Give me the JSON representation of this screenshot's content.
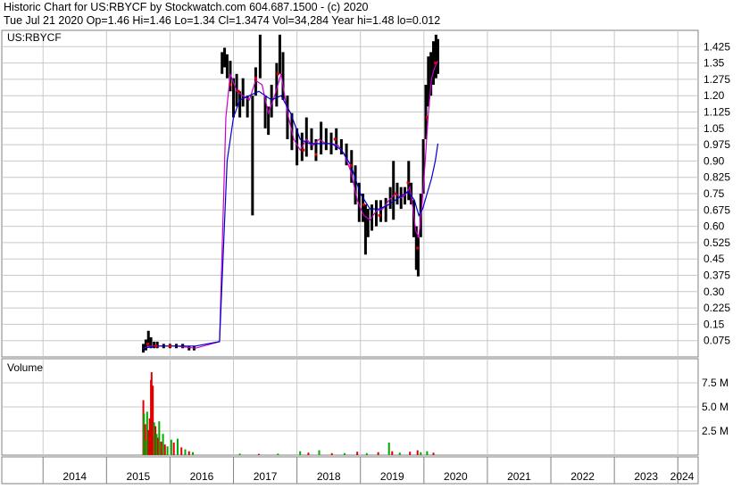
{
  "header": {
    "line1": "Historic Chart for US:RBYCF by Stockwatch.com 604.687.1500 - (c) 2020",
    "line2": "Tue Jul 21 2020  Op=1.46  Hi=1.46  Lo=1.34  Cl=1.3474  Vol=34,284  Year hi=1.48  lo=0.012"
  },
  "chart_data": [
    {
      "type": "line",
      "title": "US:RBYCF",
      "xlabel": "",
      "ylabel": "",
      "ylim": [
        0,
        1.5
      ],
      "yticks": [
        "0.075",
        "0.15",
        "0.225",
        "0.30",
        "0.375",
        "0.45",
        "0.525",
        "0.60",
        "0.675",
        "0.75",
        "0.825",
        "0.90",
        "0.975",
        "1.05",
        "1.125",
        "1.20",
        "1.275",
        "1.35",
        "1.425"
      ],
      "xtick_labels": [
        "2014",
        "2015",
        "2016",
        "2017",
        "2018",
        "2019",
        "2020",
        "2021",
        "2022",
        "2023",
        "2024"
      ],
      "grid": true,
      "legend": "none",
      "price_color": "#000000",
      "colors": {
        "ma_short": "#cc00cc",
        "ma_long": "#0000cc",
        "trade_marks": "#dd0000"
      },
      "price_ranges": [
        {
          "t": 2015.58,
          "low": 0.02,
          "high": 0.06
        },
        {
          "t": 2015.62,
          "low": 0.03,
          "high": 0.08
        },
        {
          "t": 2015.66,
          "low": 0.05,
          "high": 0.12
        },
        {
          "t": 2015.7,
          "low": 0.04,
          "high": 0.09
        },
        {
          "t": 2015.75,
          "low": 0.04,
          "high": 0.07
        },
        {
          "t": 2015.8,
          "low": 0.04,
          "high": 0.07
        },
        {
          "t": 2015.9,
          "low": 0.04,
          "high": 0.06
        },
        {
          "t": 2016.0,
          "low": 0.04,
          "high": 0.06
        },
        {
          "t": 2016.1,
          "low": 0.04,
          "high": 0.06
        },
        {
          "t": 2016.2,
          "low": 0.04,
          "high": 0.06
        },
        {
          "t": 2016.3,
          "low": 0.03,
          "high": 0.05
        },
        {
          "t": 2016.38,
          "low": 0.03,
          "high": 0.05
        },
        {
          "t": 2016.82,
          "low": 1.3,
          "high": 1.4
        },
        {
          "t": 2016.86,
          "low": 1.33,
          "high": 1.42
        },
        {
          "t": 2016.9,
          "low": 1.28,
          "high": 1.39
        },
        {
          "t": 2016.95,
          "low": 1.22,
          "high": 1.36
        },
        {
          "t": 2017.0,
          "low": 1.1,
          "high": 1.28
        },
        {
          "t": 2017.05,
          "low": 1.15,
          "high": 1.3
        },
        {
          "t": 2017.1,
          "low": 1.1,
          "high": 1.22
        },
        {
          "t": 2017.15,
          "low": 1.15,
          "high": 1.28
        },
        {
          "t": 2017.22,
          "low": 1.1,
          "high": 1.2
        },
        {
          "t": 2017.3,
          "low": 0.65,
          "high": 1.2
        },
        {
          "t": 2017.35,
          "low": 1.2,
          "high": 1.33
        },
        {
          "t": 2017.42,
          "low": 1.28,
          "high": 1.48
        },
        {
          "t": 2017.5,
          "low": 1.05,
          "high": 1.2
        },
        {
          "t": 2017.55,
          "low": 1.02,
          "high": 1.15
        },
        {
          "t": 2017.6,
          "low": 1.1,
          "high": 1.25
        },
        {
          "t": 2017.68,
          "low": 1.15,
          "high": 1.35
        },
        {
          "t": 2017.73,
          "low": 1.3,
          "high": 1.48
        },
        {
          "t": 2017.78,
          "low": 1.18,
          "high": 1.4
        },
        {
          "t": 2017.85,
          "low": 1.0,
          "high": 1.2
        },
        {
          "t": 2017.92,
          "low": 0.95,
          "high": 1.12
        },
        {
          "t": 2018.0,
          "low": 0.88,
          "high": 1.05
        },
        {
          "t": 2018.08,
          "low": 0.9,
          "high": 1.03
        },
        {
          "t": 2018.15,
          "low": 0.92,
          "high": 1.1
        },
        {
          "t": 2018.23,
          "low": 0.95,
          "high": 1.05
        },
        {
          "t": 2018.3,
          "low": 0.9,
          "high": 1.0
        },
        {
          "t": 2018.38,
          "low": 0.93,
          "high": 1.08
        },
        {
          "t": 2018.46,
          "low": 0.95,
          "high": 1.05
        },
        {
          "t": 2018.54,
          "low": 0.93,
          "high": 1.03
        },
        {
          "t": 2018.62,
          "low": 0.95,
          "high": 1.05
        },
        {
          "t": 2018.7,
          "low": 0.93,
          "high": 1.0
        },
        {
          "t": 2018.78,
          "low": 0.88,
          "high": 0.98
        },
        {
          "t": 2018.86,
          "low": 0.8,
          "high": 0.95
        },
        {
          "t": 2018.92,
          "low": 0.7,
          "high": 0.88
        },
        {
          "t": 2018.98,
          "low": 0.62,
          "high": 0.8
        },
        {
          "t": 2019.04,
          "low": 0.62,
          "high": 0.75
        },
        {
          "t": 2019.08,
          "low": 0.47,
          "high": 0.7
        },
        {
          "t": 2019.12,
          "low": 0.55,
          "high": 0.68
        },
        {
          "t": 2019.18,
          "low": 0.58,
          "high": 0.7
        },
        {
          "t": 2019.25,
          "low": 0.6,
          "high": 0.72
        },
        {
          "t": 2019.32,
          "low": 0.62,
          "high": 0.72
        },
        {
          "t": 2019.4,
          "low": 0.62,
          "high": 0.73
        },
        {
          "t": 2019.47,
          "low": 0.68,
          "high": 0.78
        },
        {
          "t": 2019.52,
          "low": 0.63,
          "high": 0.9
        },
        {
          "t": 2019.58,
          "low": 0.7,
          "high": 0.8
        },
        {
          "t": 2019.64,
          "low": 0.68,
          "high": 0.78
        },
        {
          "t": 2019.7,
          "low": 0.7,
          "high": 0.78
        },
        {
          "t": 2019.76,
          "low": 0.72,
          "high": 0.9
        },
        {
          "t": 2019.8,
          "low": 0.7,
          "high": 0.8
        },
        {
          "t": 2019.84,
          "low": 0.55,
          "high": 0.72
        },
        {
          "t": 2019.88,
          "low": 0.4,
          "high": 0.6
        },
        {
          "t": 2019.91,
          "low": 0.37,
          "high": 0.55
        },
        {
          "t": 2019.95,
          "low": 0.55,
          "high": 0.75
        },
        {
          "t": 2019.99,
          "low": 0.75,
          "high": 1.0
        },
        {
          "t": 2020.03,
          "low": 1.0,
          "high": 1.25
        },
        {
          "t": 2020.07,
          "low": 1.15,
          "high": 1.38
        },
        {
          "t": 2020.11,
          "low": 1.2,
          "high": 1.4
        },
        {
          "t": 2020.15,
          "low": 1.25,
          "high": 1.45
        },
        {
          "t": 2020.19,
          "low": 1.28,
          "high": 1.48
        },
        {
          "t": 2020.22,
          "low": 1.3,
          "high": 1.46
        }
      ],
      "series": [
        {
          "key": "ma_short",
          "points": [
            [
              2015.58,
              0.04
            ],
            [
              2015.7,
              0.05
            ],
            [
              2015.85,
              0.05
            ],
            [
              2016.1,
              0.05
            ],
            [
              2016.4,
              0.04
            ],
            [
              2016.78,
              0.07
            ],
            [
              2016.88,
              1.1
            ],
            [
              2016.95,
              1.3
            ],
            [
              2017.05,
              1.22
            ],
            [
              2017.15,
              1.2
            ],
            [
              2017.25,
              1.18
            ],
            [
              2017.35,
              1.27
            ],
            [
              2017.45,
              1.25
            ],
            [
              2017.55,
              1.12
            ],
            [
              2017.65,
              1.2
            ],
            [
              2017.75,
              1.3
            ],
            [
              2017.85,
              1.12
            ],
            [
              2017.95,
              1.0
            ],
            [
              2018.05,
              0.95
            ],
            [
              2018.15,
              1.0
            ],
            [
              2018.25,
              0.97
            ],
            [
              2018.35,
              1.0
            ],
            [
              2018.45,
              0.98
            ],
            [
              2018.55,
              0.98
            ],
            [
              2018.65,
              0.97
            ],
            [
              2018.75,
              0.93
            ],
            [
              2018.85,
              0.85
            ],
            [
              2018.95,
              0.72
            ],
            [
              2019.05,
              0.65
            ],
            [
              2019.15,
              0.63
            ],
            [
              2019.25,
              0.67
            ],
            [
              2019.35,
              0.68
            ],
            [
              2019.45,
              0.72
            ],
            [
              2019.55,
              0.75
            ],
            [
              2019.65,
              0.73
            ],
            [
              2019.72,
              0.75
            ],
            [
              2019.78,
              0.78
            ],
            [
              2019.82,
              0.7
            ],
            [
              2019.87,
              0.58
            ],
            [
              2019.92,
              0.55
            ],
            [
              2019.97,
              0.7
            ],
            [
              2020.02,
              0.9
            ],
            [
              2020.07,
              1.12
            ],
            [
              2020.12,
              1.28
            ],
            [
              2020.17,
              1.33
            ],
            [
              2020.22,
              1.36
            ]
          ]
        },
        {
          "key": "ma_long",
          "points": [
            [
              2015.58,
              0.04
            ],
            [
              2015.8,
              0.05
            ],
            [
              2016.1,
              0.05
            ],
            [
              2016.4,
              0.05
            ],
            [
              2016.78,
              0.07
            ],
            [
              2016.9,
              0.9
            ],
            [
              2017.0,
              1.1
            ],
            [
              2017.1,
              1.18
            ],
            [
              2017.25,
              1.2
            ],
            [
              2017.4,
              1.22
            ],
            [
              2017.6,
              1.18
            ],
            [
              2017.75,
              1.2
            ],
            [
              2017.9,
              1.12
            ],
            [
              2018.05,
              1.0
            ],
            [
              2018.2,
              0.98
            ],
            [
              2018.4,
              0.98
            ],
            [
              2018.55,
              0.98
            ],
            [
              2018.7,
              0.95
            ],
            [
              2018.85,
              0.88
            ],
            [
              2019.0,
              0.75
            ],
            [
              2019.15,
              0.68
            ],
            [
              2019.3,
              0.68
            ],
            [
              2019.45,
              0.7
            ],
            [
              2019.6,
              0.73
            ],
            [
              2019.75,
              0.76
            ],
            [
              2019.85,
              0.72
            ],
            [
              2019.92,
              0.65
            ],
            [
              2019.98,
              0.68
            ],
            [
              2020.05,
              0.75
            ],
            [
              2020.12,
              0.82
            ],
            [
              2020.18,
              0.9
            ],
            [
              2020.22,
              0.98
            ]
          ]
        }
      ],
      "trade_marks": [
        [
          2015.65,
          0.06
        ],
        [
          2015.78,
          0.05
        ],
        [
          2016.0,
          0.05
        ],
        [
          2016.95,
          1.25
        ],
        [
          2017.08,
          1.22
        ],
        [
          2017.35,
          1.28
        ],
        [
          2017.7,
          1.3
        ],
        [
          2018.1,
          0.95
        ],
        [
          2018.3,
          0.93
        ],
        [
          2018.6,
          1.0
        ],
        [
          2018.85,
          0.88
        ],
        [
          2019.05,
          0.7
        ],
        [
          2019.3,
          0.65
        ],
        [
          2019.55,
          0.75
        ],
        [
          2019.75,
          0.8
        ],
        [
          2019.9,
          0.5
        ],
        [
          2020.05,
          1.1
        ],
        [
          2020.18,
          1.35
        ]
      ]
    },
    {
      "type": "bar",
      "title": "Volume",
      "ylim": [
        0,
        10000000
      ],
      "yticks": [
        "2.5 M",
        "5.0 M",
        "7.5 M"
      ],
      "up_color": "#00aa00",
      "down_color": "#dd0000",
      "bars": [
        [
          2015.58,
          5700000,
          "down"
        ],
        [
          2015.59,
          4300000,
          "up"
        ],
        [
          2015.61,
          3200000,
          "down"
        ],
        [
          2015.62,
          1500000,
          "up"
        ],
        [
          2015.64,
          4500000,
          "up"
        ],
        [
          2015.66,
          2600000,
          "down"
        ],
        [
          2015.68,
          3800000,
          "down"
        ],
        [
          2015.7,
          7800000,
          "down"
        ],
        [
          2015.71,
          8600000,
          "down"
        ],
        [
          2015.73,
          7200000,
          "down"
        ],
        [
          2015.75,
          3400000,
          "up"
        ],
        [
          2015.77,
          3000000,
          "down"
        ],
        [
          2015.79,
          2200000,
          "up"
        ],
        [
          2015.81,
          1800000,
          "down"
        ],
        [
          2015.83,
          3500000,
          "up"
        ],
        [
          2015.86,
          1400000,
          "down"
        ],
        [
          2015.89,
          2200000,
          "up"
        ],
        [
          2015.92,
          1100000,
          "down"
        ],
        [
          2015.96,
          900000,
          "up"
        ],
        [
          2016.02,
          1600000,
          "up"
        ],
        [
          2016.06,
          1300000,
          "down"
        ],
        [
          2016.12,
          1700000,
          "up"
        ],
        [
          2016.18,
          800000,
          "down"
        ],
        [
          2016.24,
          600000,
          "up"
        ],
        [
          2016.3,
          400000,
          "down"
        ],
        [
          2016.36,
          300000,
          "up"
        ],
        [
          2017.1,
          150000,
          "up"
        ],
        [
          2017.4,
          120000,
          "down"
        ],
        [
          2017.7,
          150000,
          "up"
        ],
        [
          2018.05,
          400000,
          "up"
        ],
        [
          2018.18,
          250000,
          "down"
        ],
        [
          2018.35,
          500000,
          "up"
        ],
        [
          2018.55,
          200000,
          "down"
        ],
        [
          2018.75,
          200000,
          "up"
        ],
        [
          2018.95,
          350000,
          "down"
        ],
        [
          2019.1,
          200000,
          "up"
        ],
        [
          2019.28,
          300000,
          "down"
        ],
        [
          2019.45,
          1300000,
          "up"
        ],
        [
          2019.5,
          400000,
          "down"
        ],
        [
          2019.62,
          250000,
          "up"
        ],
        [
          2019.78,
          350000,
          "down"
        ],
        [
          2019.9,
          500000,
          "down"
        ],
        [
          2019.95,
          300000,
          "up"
        ],
        [
          2020.05,
          400000,
          "up"
        ],
        [
          2020.15,
          250000,
          "down"
        ]
      ]
    }
  ]
}
